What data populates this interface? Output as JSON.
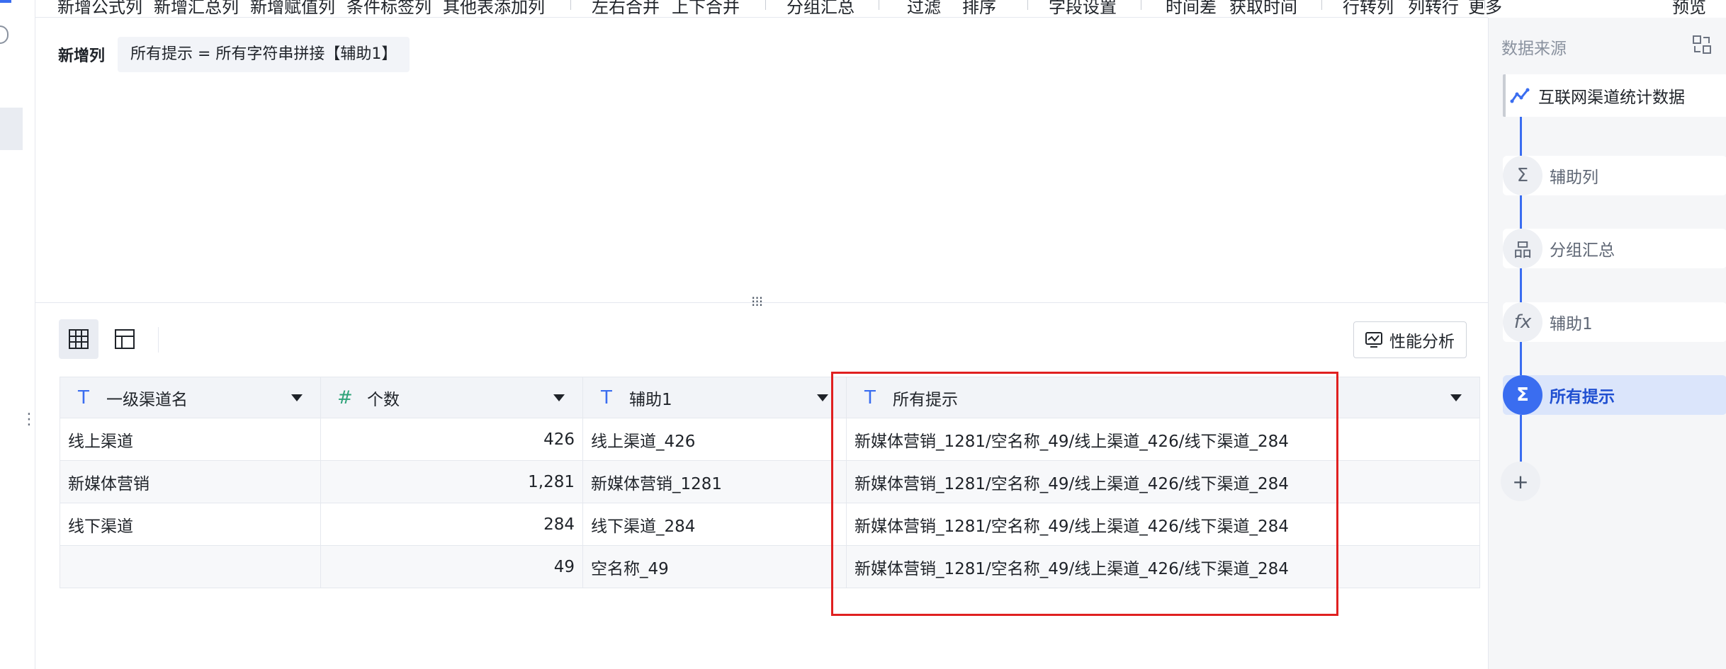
{
  "toolbar": {
    "items": [
      "新增公式列",
      "新增汇总列",
      "新增赋值列",
      "条件标签列",
      "其他表添加列",
      "左右合并",
      "上下合并",
      "分组汇总",
      "过滤",
      "排序",
      "字段设置",
      "时间差",
      "获取时间",
      "行转列",
      "列转行",
      "更多",
      "预览"
    ]
  },
  "formula": {
    "title": "新增列",
    "expression": "所有提示 = 所有字符串拼接【辅助1】"
  },
  "perf_button": "性能分析",
  "table": {
    "columns": [
      {
        "name": "一级渠道名",
        "type_icon": "text-type-icon",
        "glyph": "T"
      },
      {
        "name": "个数",
        "type_icon": "number-type-icon",
        "glyph": "#"
      },
      {
        "name": "辅助1",
        "type_icon": "text-type-icon",
        "glyph": "T"
      },
      {
        "name": "所有提示",
        "type_icon": "text-type-icon",
        "glyph": "T"
      }
    ],
    "rows": [
      [
        "线上渠道",
        "426",
        "线上渠道_426",
        "新媒体营销_1281/空名称_49/线上渠道_426/线下渠道_284"
      ],
      [
        "新媒体营销",
        "1,281",
        "新媒体营销_1281",
        "新媒体营销_1281/空名称_49/线上渠道_426/线下渠道_284"
      ],
      [
        "线下渠道",
        "284",
        "线下渠道_284",
        "新媒体营销_1281/空名称_49/线上渠道_426/线下渠道_284"
      ],
      [
        "",
        "49",
        "空名称_49",
        "新媒体营销_1281/空名称_49/线上渠道_426/线下渠道_284"
      ]
    ]
  },
  "right_panel": {
    "title": "数据来源",
    "steps": [
      {
        "label": "互联网渠道统计数据",
        "icon": "line-chart-icon",
        "glyph": "⟋"
      },
      {
        "label": "辅助列",
        "icon": "sigma-icon",
        "glyph": "Σ"
      },
      {
        "label": "分组汇总",
        "icon": "group-icon",
        "glyph": "品"
      },
      {
        "label": "辅助1",
        "icon": "fx-icon",
        "glyph": "fx"
      },
      {
        "label": "所有提示",
        "icon": "sigma-icon",
        "glyph": "Σ"
      }
    ],
    "add_label": "+"
  },
  "colors": {
    "accent": "#3a6df0",
    "highlight": "#e02020",
    "number_icon": "#2fa37a"
  }
}
